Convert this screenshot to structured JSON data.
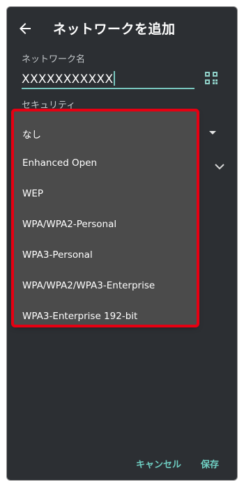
{
  "app_bar": {
    "title": "ネットワークを追加",
    "back_icon": "arrow-left-icon"
  },
  "network_name": {
    "label": "ネットワーク名",
    "value": "XXXXXXXXXXX",
    "qr_icon": "qr-code-scan-icon"
  },
  "security": {
    "label": "セキュリティ",
    "dropdown_icon": "caret-down-icon",
    "options": [
      "なし",
      "Enhanced Open",
      "WEP",
      "WPA/WPA2-Personal",
      "WPA3-Personal",
      "WPA/WPA2/WPA3-Enterprise",
      "WPA3-Enterprise 192-bit"
    ]
  },
  "advanced": {
    "expand_icon": "chevron-down-icon"
  },
  "buttons": {
    "cancel": "キャンセル",
    "save": "保存"
  },
  "colors": {
    "background": "#2c2f33",
    "accent": "#79c7bf",
    "highlight": "#e60012",
    "menu": "#4b4b4b"
  }
}
